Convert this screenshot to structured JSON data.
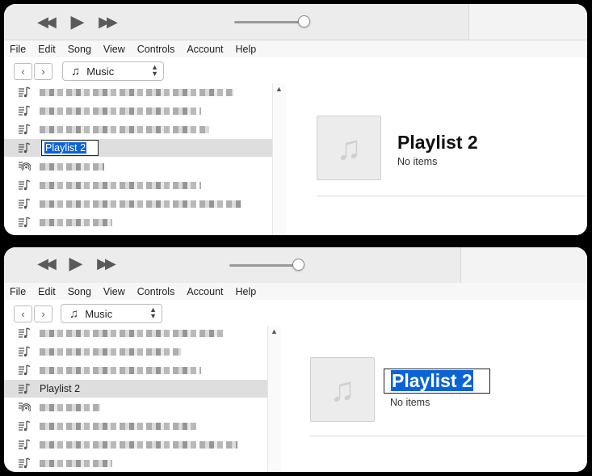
{
  "transport": {
    "rewind_icon": "rewind-icon",
    "play_icon": "play-icon",
    "forward_icon": "fast-forward-icon",
    "volume_level": 0.82
  },
  "menu": [
    "File",
    "Edit",
    "Song",
    "View",
    "Controls",
    "Account",
    "Help"
  ],
  "nav": {
    "back_glyph": "‹",
    "forward_glyph": "›",
    "source_icon": "♫",
    "source_label": "Music"
  },
  "playlist": {
    "name": "Playlist 2",
    "status": "No items"
  },
  "colors": {
    "selection": "#0a64d6"
  }
}
